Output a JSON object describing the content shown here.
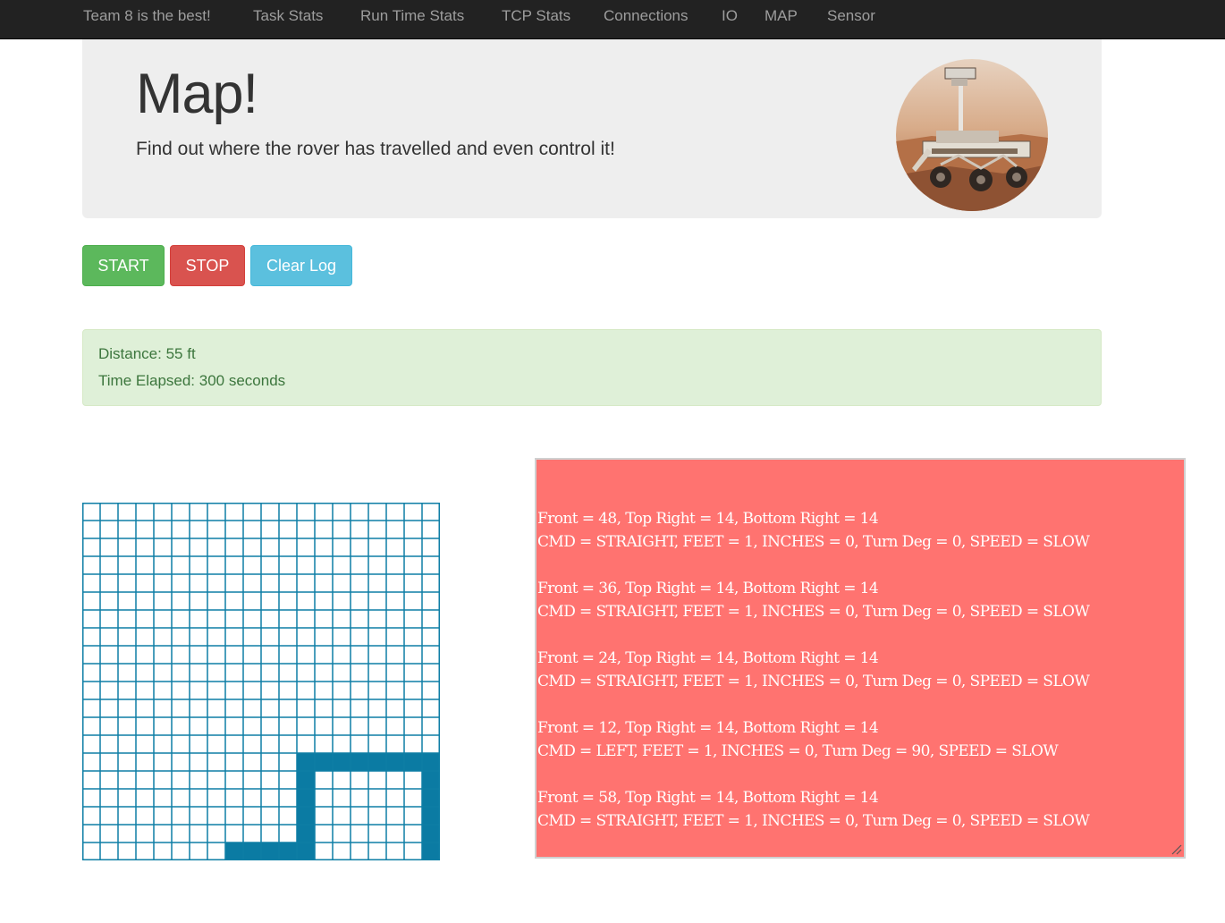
{
  "navbar": {
    "brand": "Team 8 is the best!",
    "items": [
      "Task Stats",
      "Run Time Stats",
      "TCP Stats",
      "Connections",
      "IO",
      "MAP",
      "Sensor"
    ]
  },
  "jumbotron": {
    "title": "Map!",
    "subtitle": "Find out where the rover has travelled and even control it!",
    "image_icon": "mars-rover-photo"
  },
  "buttons": {
    "start": "START",
    "stop": "STOP",
    "clear": "Clear Log"
  },
  "stats": {
    "distance": "Distance: 55 ft",
    "time": "Time Elapsed: 300 seconds"
  },
  "map": {
    "rows": 20,
    "cols": 20,
    "grid_color": "#0e7ea5",
    "path_color": "#0b7ba3",
    "path_cells": [
      [
        14,
        12
      ],
      [
        14,
        13
      ],
      [
        14,
        14
      ],
      [
        14,
        15
      ],
      [
        14,
        16
      ],
      [
        14,
        17
      ],
      [
        14,
        18
      ],
      [
        14,
        19
      ],
      [
        15,
        12
      ],
      [
        16,
        12
      ],
      [
        17,
        12
      ],
      [
        18,
        12
      ],
      [
        15,
        19
      ],
      [
        16,
        19
      ],
      [
        17,
        19
      ],
      [
        18,
        19
      ],
      [
        19,
        19
      ],
      [
        19,
        8
      ],
      [
        19,
        9
      ],
      [
        19,
        10
      ],
      [
        19,
        11
      ],
      [
        19,
        12
      ]
    ]
  },
  "log": {
    "background": "#ff7370",
    "lines": [
      "Front = 48, Top Right = 14, Bottom Right = 14",
      "CMD = STRAIGHT, FEET = 1, INCHES = 0, Turn Deg = 0, SPEED = SLOW",
      "",
      "Front = 36, Top Right = 14, Bottom Right = 14",
      "CMD = STRAIGHT, FEET = 1, INCHES = 0, Turn Deg = 0, SPEED = SLOW",
      "",
      "Front = 24, Top Right = 14, Bottom Right = 14",
      "CMD = STRAIGHT, FEET = 1, INCHES = 0, Turn Deg = 0, SPEED = SLOW",
      "",
      "Front = 12, Top Right = 14, Bottom Right = 14",
      "CMD = LEFT, FEET = 1, INCHES = 0, Turn Deg = 90, SPEED = SLOW",
      "",
      "Front = 58, Top Right = 14, Bottom Right = 14",
      "CMD = STRAIGHT, FEET = 1, INCHES = 0, Turn Deg = 0, SPEED = SLOW"
    ]
  }
}
